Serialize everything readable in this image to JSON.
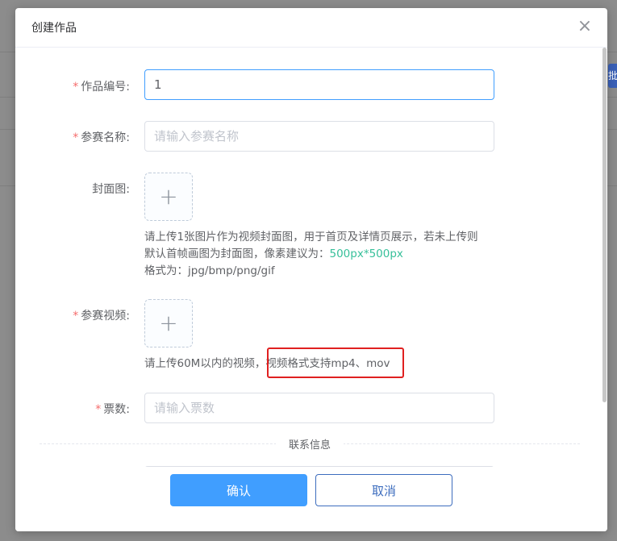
{
  "dialog": {
    "title": "创建作品",
    "close_icon": "×"
  },
  "form": {
    "work_number": {
      "label": "作品编号:",
      "value": "1",
      "required_mark": "*"
    },
    "entry_name": {
      "label": "参赛名称:",
      "placeholder": "请输入参赛名称",
      "required_mark": "*"
    },
    "cover": {
      "label": "封面图:",
      "upload_icon": "+",
      "hint_line1": "请上传1张图片作为视频封面图，用于首页及详情页展示，若未上传则",
      "hint_line2_prefix": "默认首帧画图为封面图，像素建议为：",
      "hint_line2_accent": "500px*500px",
      "hint_line3": "格式为：jpg/bmp/png/gif"
    },
    "video": {
      "label": "参赛视频:",
      "required_mark": "*",
      "upload_icon": "+",
      "hint_prefix": "请上传60M以内的视频，",
      "hint_highlight": "视频格式支持mp4、mov"
    },
    "votes": {
      "label": "票数:",
      "placeholder": "请输入票数",
      "required_mark": "*"
    },
    "contact_divider": "联系信息"
  },
  "footer": {
    "confirm_label": "确认",
    "cancel_label": "取消"
  },
  "colors": {
    "primary": "#409eff",
    "accent_green": "#37c09a",
    "required_red": "#f56c6c",
    "highlight_red": "#e02020"
  },
  "background": {
    "side_tab_label": "批"
  }
}
